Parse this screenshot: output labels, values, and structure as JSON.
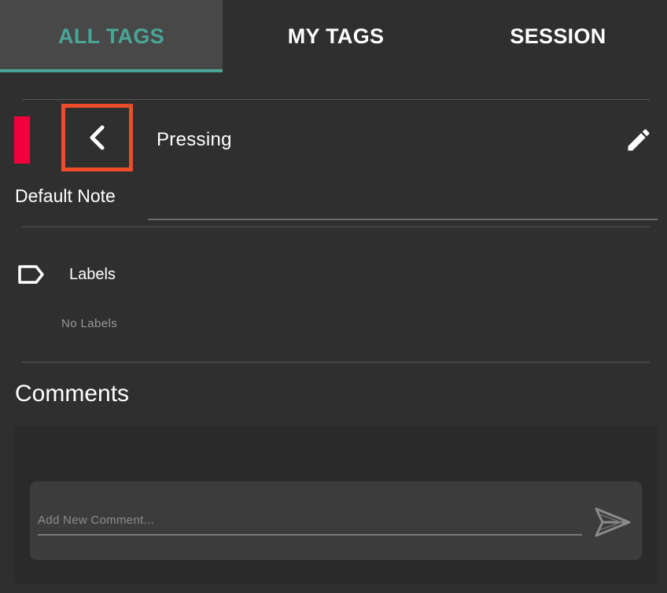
{
  "tabs": [
    {
      "label": "ALL TAGS",
      "active": true
    },
    {
      "label": "MY TAGS",
      "active": false
    },
    {
      "label": "SESSION",
      "active": false
    }
  ],
  "colors": {
    "accent": "#4aa596",
    "tag_color": "#f0003c",
    "highlight_border": "#ee4b2b",
    "background": "#2f2f2f"
  },
  "tag": {
    "title": "Pressing",
    "note_label": "Default Note",
    "back_icon": "chevron-left-icon",
    "edit_icon": "pencil-icon"
  },
  "labels": {
    "title": "Labels",
    "empty_text": "No Labels",
    "icon": "label-tag-icon"
  },
  "comments": {
    "title": "Comments",
    "placeholder": "Add New Comment...",
    "value": "",
    "send_icon": "send-icon"
  }
}
